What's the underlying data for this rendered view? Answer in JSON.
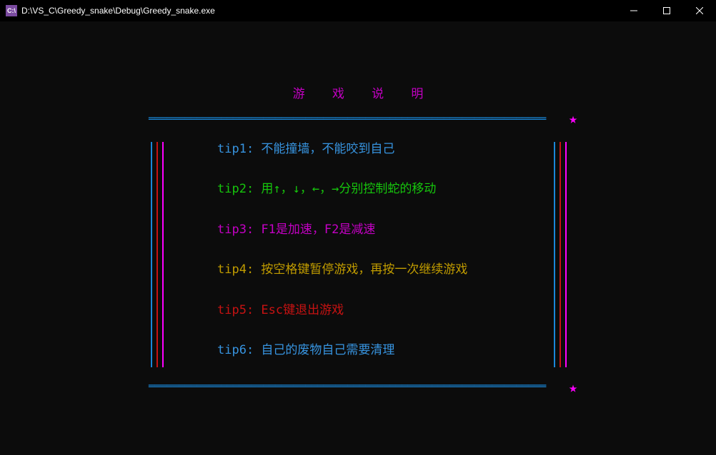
{
  "window": {
    "title": "D:\\VS_C\\Greedy_snake\\Debug\\Greedy_snake.exe",
    "icon_text": "C:\\"
  },
  "heading": {
    "c1": "游",
    "c2": "戏",
    "c3": "说",
    "c4": "明"
  },
  "border": {
    "hline": "══════════════════════════════════════════════════════════════════",
    "star": "★"
  },
  "tips": [
    {
      "label": "tip1:",
      "text": " 不能撞墙，不能咬到自己",
      "color": "c-blue"
    },
    {
      "label": "tip2:",
      "text": " 用↑，↓，←，→分别控制蛇的移动",
      "color": "c-green"
    },
    {
      "label": "tip3:",
      "text": " F1是加速，F2是减速",
      "color": "c-mag"
    },
    {
      "label": "tip4:",
      "text": " 按空格键暂停游戏，再按一次继续游戏",
      "color": "c-yellow"
    },
    {
      "label": "tip5:",
      "text": " Esc键退出游戏",
      "color": "c-red"
    },
    {
      "label": "tip6:",
      "text": " 自己的废物自己需要清理",
      "color": "c-blue"
    }
  ]
}
